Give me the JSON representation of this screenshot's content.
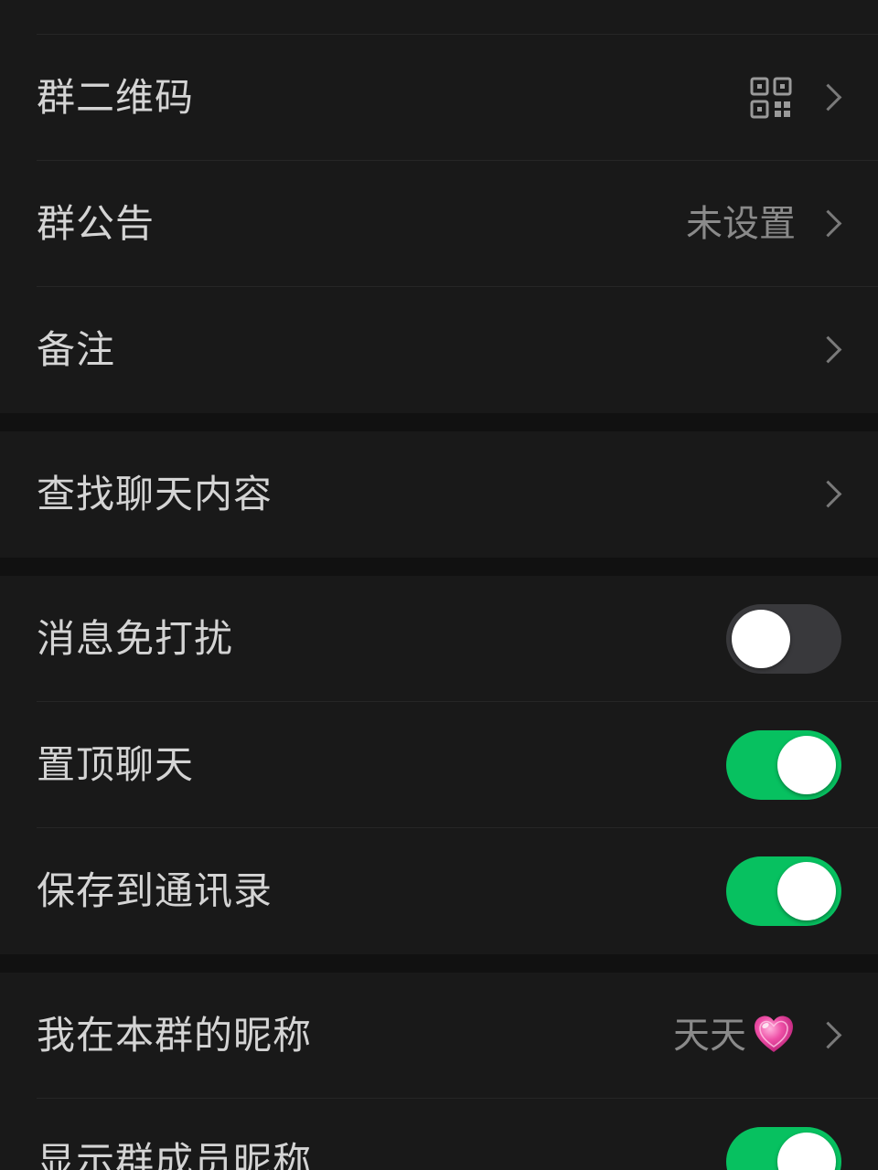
{
  "group_info": {
    "qr_code": {
      "label": "群二维码",
      "icon": "qr-code-icon"
    },
    "announcement": {
      "label": "群公告",
      "value": "未设置"
    },
    "remark": {
      "label": "备注"
    }
  },
  "search": {
    "find_chat": {
      "label": "查找聊天内容"
    }
  },
  "settings": {
    "mute": {
      "label": "消息免打扰",
      "enabled": false
    },
    "pin": {
      "label": "置顶聊天",
      "enabled": true
    },
    "save_contacts": {
      "label": "保存到通讯录",
      "enabled": true
    }
  },
  "nickname": {
    "my_nickname": {
      "label": "我在本群的昵称",
      "value": "天天",
      "emoji": "heart-icon"
    },
    "show_nicknames": {
      "label": "显示群成员昵称",
      "enabled": true
    }
  },
  "colors": {
    "toggle_on": "#07c160",
    "toggle_off": "#39393c",
    "background": "#111111",
    "cell": "#191919"
  }
}
